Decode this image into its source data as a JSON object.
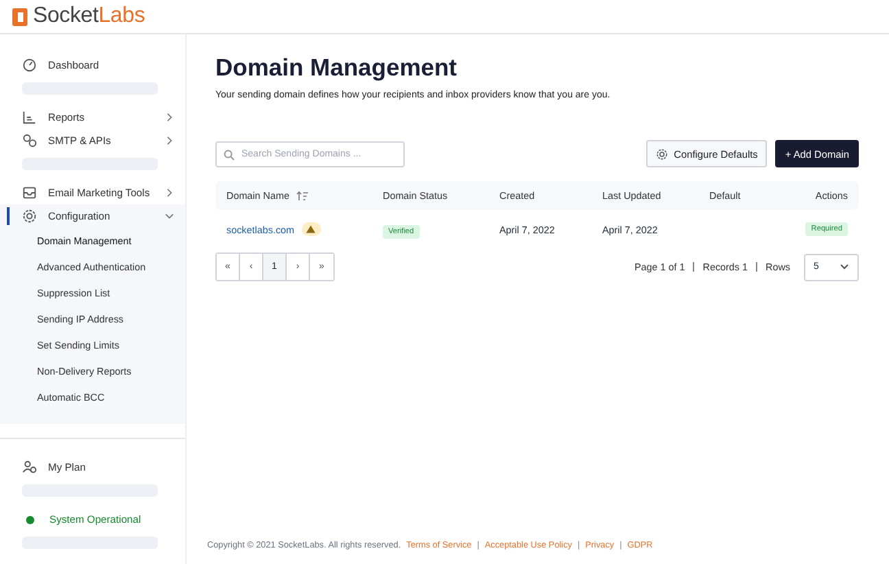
{
  "logo": {
    "parts": [
      "Socket",
      "Labs"
    ]
  },
  "sidebar": {
    "items": [
      {
        "kind": "link",
        "label": "Dashboard",
        "selected": false
      },
      {
        "kind": "skeleton"
      },
      {
        "kind": "link",
        "label": "Reports",
        "selected": false,
        "expanded": false
      },
      {
        "kind": "link",
        "label": "SMTP & APIs",
        "selected": false,
        "expanded": false
      },
      {
        "kind": "skeleton"
      },
      {
        "kind": "link",
        "label": "Email Marketing Tools",
        "selected": false,
        "expanded": false
      },
      {
        "kind": "link",
        "label": "Configuration",
        "selected": true,
        "expanded": true,
        "children": [
          {
            "label": "Domain Management",
            "selected": true
          },
          {
            "label": "Advanced Authentication",
            "selected": false
          },
          {
            "label": "Suppression List",
            "selected": false
          },
          {
            "label": "Sending IP Address",
            "selected": false
          },
          {
            "label": "Set Sending Limits",
            "selected": false
          },
          {
            "label": "Non-Delivery Reports",
            "selected": false
          },
          {
            "label": "Automatic BCC",
            "selected": false
          }
        ]
      }
    ],
    "bottom_items": [
      {
        "kind": "link",
        "label": "My Plan",
        "selected": false
      },
      {
        "kind": "skeleton"
      },
      {
        "kind": "status",
        "label": "System Operational",
        "color": "#168a2e"
      },
      {
        "kind": "skeleton"
      }
    ]
  },
  "page": {
    "title": "Domain Management",
    "subtitle": "Your sending domain defines how your recipients and inbox providers know that you are you."
  },
  "toolbar": {
    "search": {
      "placeholder": "Search Sending Domains ..."
    },
    "configure_button": "Configure Defaults",
    "add_button": "+ Add Domain"
  },
  "table": {
    "columns": [
      {
        "label": "Domain Name",
        "sortable": true
      },
      {
        "label": "Domain Status",
        "sortable": false
      },
      {
        "label": "Created",
        "sortable": false
      },
      {
        "label": "Last Updated",
        "sortable": false
      },
      {
        "label": "Default",
        "sortable": false
      },
      {
        "label": "Actions",
        "sortable": false
      }
    ],
    "rows": [
      {
        "domain": "socketlabs.com",
        "warning": true,
        "status": "Verified",
        "created": "April 7, 2022",
        "updated": "April 7, 2022",
        "action": "Required"
      }
    ]
  },
  "pagination": {
    "buttons": [
      {
        "label": "«",
        "selected": false
      },
      {
        "label": "‹",
        "selected": false
      },
      {
        "label": "1",
        "selected": true
      },
      {
        "label": "›",
        "selected": false
      },
      {
        "label": "»",
        "selected": false
      }
    ],
    "page_info": "Page 1 of 1",
    "records": "Records 1",
    "rows_label": "Rows",
    "rows_value": "5"
  },
  "footer": {
    "copyright": "Copyright © 2021 SocketLabs. All rights reserved.",
    "links": [
      "Terms of Service",
      "Acceptable Use Policy",
      "Privacy",
      "GDPR"
    ],
    "separators": [
      "|",
      "|",
      "|"
    ]
  }
}
